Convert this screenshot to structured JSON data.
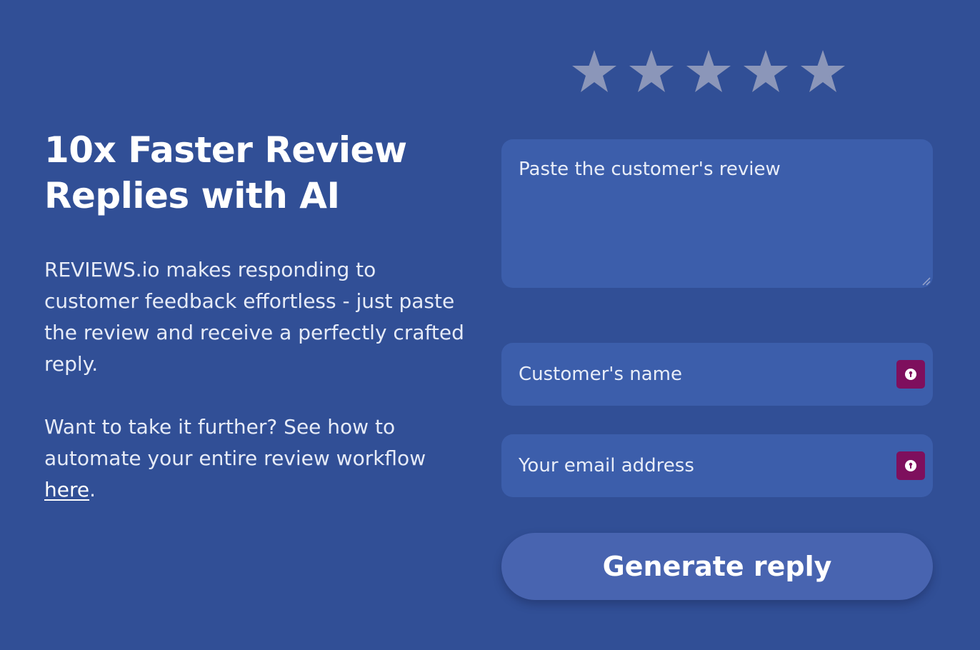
{
  "hero": {
    "headline_line1": "10x Faster Review",
    "headline_line2": "Replies with AI",
    "description": "REVIEWS.io makes responding to customer feedback effortless - just paste the review and receive a perfectly crafted reply.",
    "cta_text": "Want to take it further? See how to automate your entire review workflow ",
    "cta_link_label": "here",
    "cta_suffix": "."
  },
  "rating": {
    "max_stars": 5,
    "selected": 0,
    "star_icon": "star-icon",
    "star_color": "#8b96b9"
  },
  "form": {
    "review_placeholder": "Paste the customer's review",
    "name_placeholder": "Customer's name",
    "email_placeholder": "Your email address",
    "autofill_icon": "password-key-icon",
    "autofill_badge_color": "#7e0f5d",
    "submit_label": "Generate reply"
  },
  "colors": {
    "background": "#314f96",
    "field_background": "#3c5eab",
    "button_background": "#4864b0"
  }
}
